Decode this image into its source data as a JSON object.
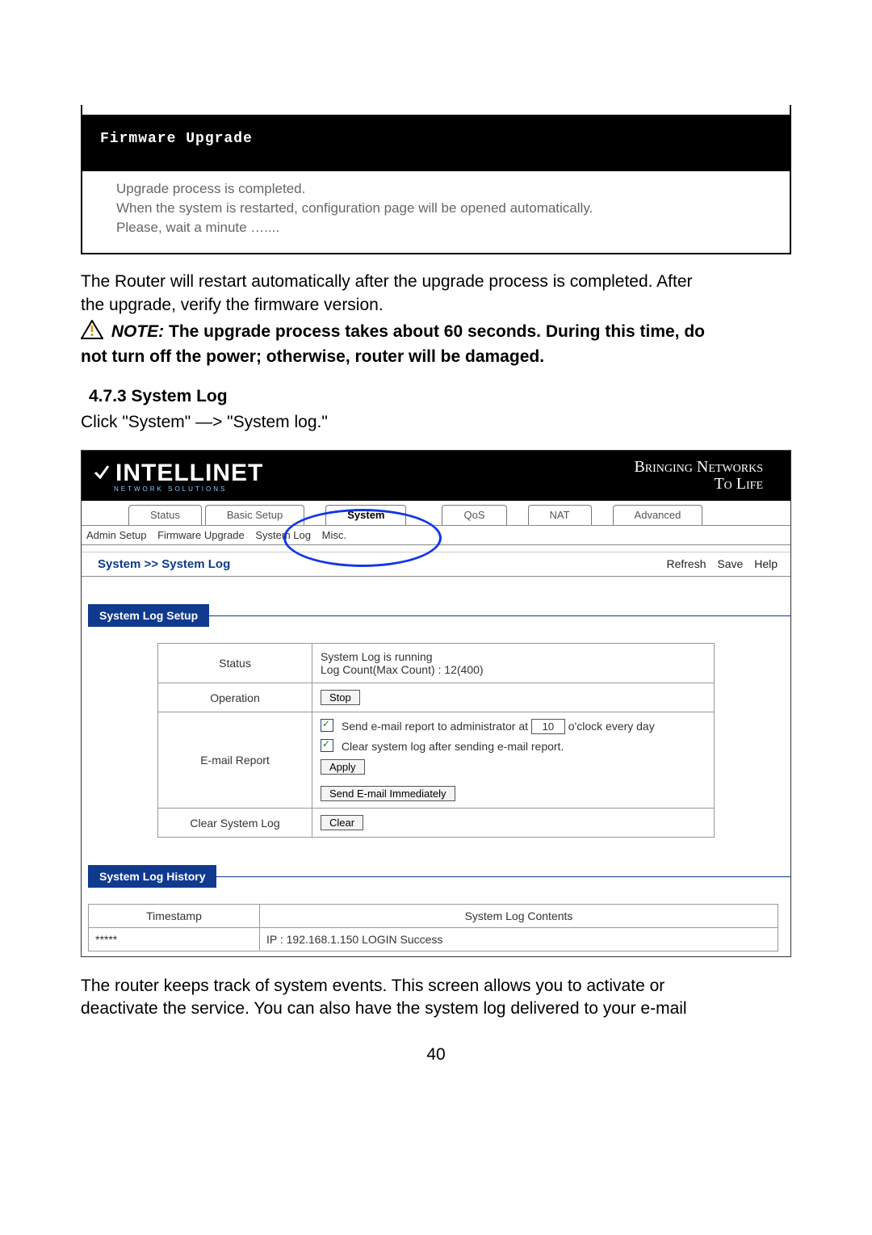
{
  "firmware_box": {
    "title": "Firmware Upgrade",
    "line1": "Upgrade process is completed.",
    "line2": "When the system is restarted, configuration page will be opened automatically.",
    "line3": "Please, wait a minute …...."
  },
  "doc": {
    "para1a": "The Router will restart automatically after the upgrade process is completed. After",
    "para1b": "the upgrade, verify the firmware version.",
    "note_label": "NOTE:",
    "note_body1": "The upgrade process takes about 60 seconds. During this time, do",
    "note_body2": "not turn off the power; otherwise, router will be damaged.",
    "heading": "4.7.3 System Log",
    "click_line": "Click \"System\" —> \"System log.\"",
    "after1": "The router keeps track of system events. This screen allows you to activate or",
    "after2": "deactivate the service. You can also have the system log delivered to your e-mail",
    "page_number": "40"
  },
  "router": {
    "brand": "INTELLINET",
    "brand_sub": "NETWORK SOLUTIONS",
    "slogan_top": "Bringing Networks",
    "slogan_bot": "To Life",
    "tabs": [
      "Status",
      "Basic Setup",
      "System",
      "QoS",
      "NAT",
      "Advanced"
    ],
    "subtabs": [
      "Admin Setup",
      "Firmware Upgrade",
      "System Log",
      "Misc."
    ],
    "breadcrumb": "System >> System Log",
    "bar_links": [
      "Refresh",
      "Save",
      "Help"
    ],
    "section_setup": "System Log Setup",
    "section_history": "System Log History",
    "setup": {
      "status_label": "Status",
      "status_line1": "System Log is running",
      "status_line2": "Log Count(Max Count) : 12(400)",
      "operation_label": "Operation",
      "stop_btn": "Stop",
      "email_label": "E-mail Report",
      "email_text_a": "Send e-mail report to administrator at",
      "email_hour": "10",
      "email_text_b": "o'clock every day",
      "email_clear": "Clear system log after sending e-mail report.",
      "apply_btn": "Apply",
      "send_now_btn": "Send E-mail Immediately",
      "clear_label": "Clear System Log",
      "clear_btn": "Clear"
    },
    "log_table": {
      "col_timestamp": "Timestamp",
      "col_contents": "System Log Contents",
      "rows": [
        {
          "ts": "*****",
          "msg": "IP : 192.168.1.150 LOGIN Success"
        }
      ]
    }
  }
}
